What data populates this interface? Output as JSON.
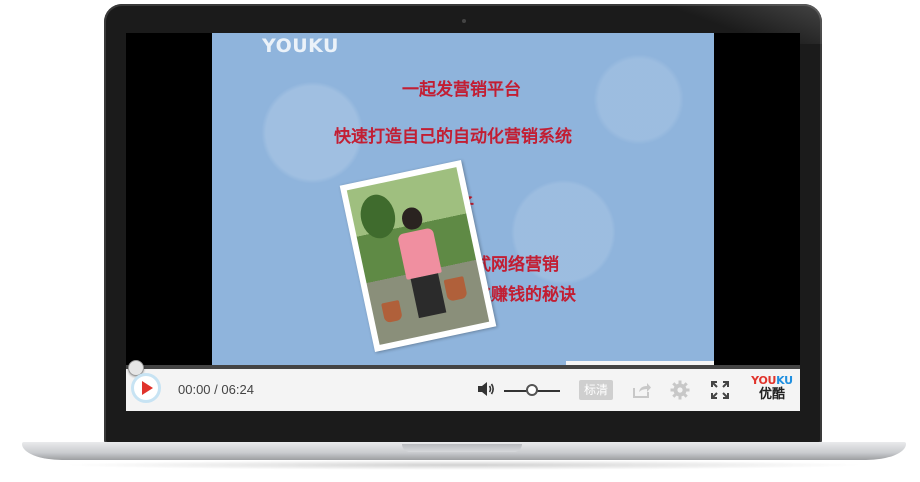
{
  "video": {
    "watermark": "YOUKU",
    "slide": {
      "line1": "一起发营销平台",
      "line2": "快速打造自己的自动化营销系统",
      "name": "强子",
      "line4": "病毒式网络营销",
      "line5": "自动化赚钱的秘诀"
    }
  },
  "player": {
    "current_time": "00:00",
    "separator": " / ",
    "duration": "06:24",
    "progress": 0.0,
    "volume": 0.5,
    "quality_label": "标清",
    "brand_logo_text": [
      "YOU",
      "KU"
    ],
    "brand_name": "优酷"
  },
  "icons": {
    "play": "play-icon",
    "volume": "volume-icon",
    "share": "share-icon",
    "settings": "gear-icon",
    "fullscreen": "fullscreen-icon"
  },
  "colors": {
    "play_accent": "#e0332b",
    "slide_text": "#c21e33",
    "slide_background": "#8fb4dc",
    "brand_blue": "#1f8fe0"
  }
}
